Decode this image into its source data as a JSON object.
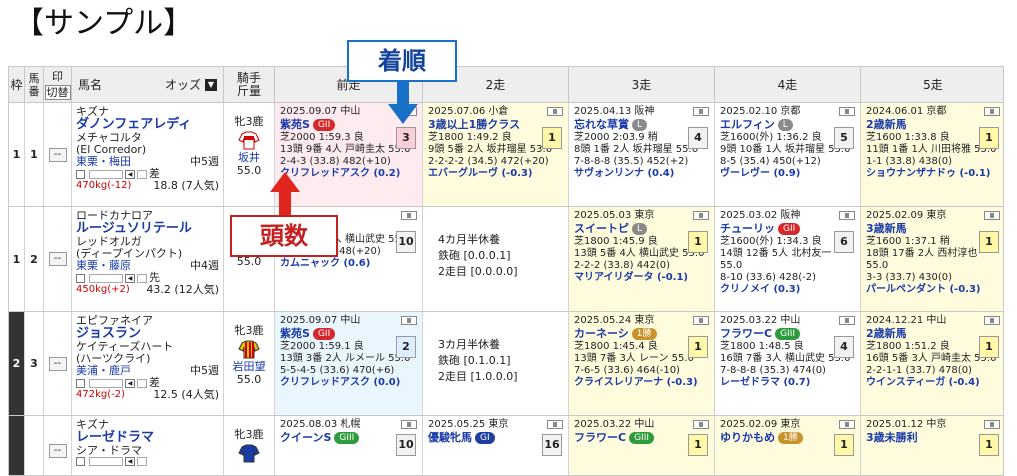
{
  "page_title": "【サンプル】",
  "callouts": {
    "finish": "着順",
    "heads": "頭数"
  },
  "header": {
    "waku": "枠",
    "umaban": "馬番",
    "mark": "印",
    "cut": "切替",
    "name": "馬名",
    "odds": "オッズ",
    "sort_icon": "sort-down-icon",
    "jockey": "騎手",
    "weight": "斤量",
    "races": [
      "前走",
      "2走",
      "3走",
      "4走",
      "5走"
    ]
  },
  "rows": [
    {
      "waku": "1",
      "uma": "1",
      "mark": "--",
      "sire": "キズナ",
      "name": "ダノンフェアレディ",
      "dam": "メチャコルタ",
      "dam_sire": "(El Corredor)",
      "trainer": "東栗・梅田",
      "rest": "中5週",
      "style": "差",
      "weight": "470kg(-12)",
      "odds": "18.8 (7人気)",
      "sex_age": "牝3鹿",
      "jockey": "坂井",
      "kinryo": "55.0",
      "races": [
        {
          "date": "2025.09.07 中山",
          "name": "紫苑S",
          "grade": "GII",
          "finish": "3",
          "info": "芝2000 1:59.3 良",
          "detail": "13頭 9番 4人 戸崎圭太 55.0",
          "pass": "2-4-3 (33.8) 482(+10)",
          "winner": "クリフレッドアスク (0.2)",
          "bg": "p",
          "fbox": "p"
        },
        {
          "date": "2025.07.06 小倉",
          "name": "3歳以上1勝クラス",
          "grade": "",
          "finish": "1",
          "info": "芝1800 1:49.2 良",
          "detail": "9頭 5番 2人 坂井瑠星 53.0",
          "pass": "2-2-2-2 (34.5) 472(+20)",
          "winner": "エバーグルーヴ (-0.3)",
          "bg": "y",
          "fbox": "y"
        },
        {
          "date": "2025.04.13 阪神",
          "name": "忘れな草賞",
          "grade": "L",
          "finish": "4",
          "info": "芝2000 2:03.9 稍",
          "detail": "8頭 1番 2人 坂井瑠星 55.0",
          "pass": "7-8-8-8 (35.5) 452(+2)",
          "winner": "サヴォンリンナ (0.4)",
          "bg": "",
          "fbox": "g"
        },
        {
          "date": "2025.02.10 京都",
          "name": "エルフィン",
          "grade": "L",
          "finish": "5",
          "info": "芝1600(外) 1:36.2 良",
          "detail": "9頭 10番 1人 坂井瑠星 55.0",
          "pass": "8-5 (35.4) 450(+12)",
          "winner": "ヴーレヴー (0.9)",
          "bg": "",
          "fbox": "g"
        },
        {
          "date": "2024.06.01 京都",
          "name": "2歳新馬",
          "grade": "",
          "finish": "1",
          "info": "芝1600 1:33.8 良",
          "detail": "11頭 1番 1人 川田将雅 55.0",
          "pass": "1-1 (33.8) 438(0)",
          "winner": "ショウナンザナドゥ (-0.1)",
          "bg": "y",
          "fbox": "y"
        }
      ]
    },
    {
      "waku": "1",
      "uma": "2",
      "mark": "--",
      "sire": "ロードカナロア",
      "name": "ルージュソリテール",
      "dam": "レッドオルガ",
      "dam_sire": "(ディープインパクト)",
      "trainer": "東栗・藤原",
      "rest": "中4週",
      "style": "先",
      "weight": "450kg(+2)",
      "odds": "43.2 (12人気)",
      "sex_age": "",
      "jockey": "北村友",
      "kinryo": "55.0",
      "races": [
        {
          "date": "神",
          "name": "",
          "grade": "",
          "finish": "10",
          "info": "4.1 良",
          "detail": "17頭 1番 4人 横山武史 55.0",
          "pass": "3-3 (35.3) 448(+20)",
          "winner": "カムニャック (0.6)",
          "bg": "",
          "fbox": "g"
        },
        {
          "rest": true,
          "text1": "4カ月半休養",
          "text2": "鉄砲 [0.0.0.1]",
          "text3": "2走目 [0.0.0.0]"
        },
        {
          "date": "2025.05.03 東京",
          "name": "スイートピ",
          "grade": "L",
          "finish": "1",
          "info": "芝1800 1:45.9 良",
          "detail": "13頭 5番 4人 横山武史 55.0",
          "pass": "2-2-2 (33.8) 442(0)",
          "winner": "マリアイリダータ (-0.1)",
          "bg": "y",
          "fbox": "y"
        },
        {
          "date": "2025.03.02 阪神",
          "name": "チューリッ",
          "grade": "GII",
          "finish": "6",
          "info": "芝1600(外) 1:34.3 良",
          "detail": "14頭 12番 5人 北村友一 55.0",
          "pass": "8-10 (33.6) 428(-2)",
          "winner": "クリノメイ (0.3)",
          "bg": "",
          "fbox": "g"
        },
        {
          "date": "2025.02.09 東京",
          "name": "3歳新馬",
          "grade": "",
          "finish": "1",
          "info": "芝1600 1:37.1 稍",
          "detail": "18頭 17番 2人 西村淳也 55.0",
          "pass": "3-3 (33.7) 430(0)",
          "winner": "パールペンダント (-0.3)",
          "bg": "y",
          "fbox": "y"
        }
      ]
    },
    {
      "waku": "2",
      "uma": "3",
      "mark": "--",
      "sire": "エピファネイア",
      "name": "ジョスラン",
      "dam": "ケイティーズハート",
      "dam_sire": "(ハーツクライ)",
      "trainer": "美浦・鹿戸",
      "rest": "中5週",
      "style": "差",
      "weight": "472kg(-2)",
      "odds": "12.5 (4人気)",
      "sex_age": "牝3鹿",
      "jockey": "岩田望",
      "kinryo": "55.0",
      "races": [
        {
          "date": "2025.09.07 中山",
          "name": "紫苑S",
          "grade": "GII",
          "finish": "2",
          "info": "芝2000 1:59.1 良",
          "detail": "13頭 3番 2人 ルメール 55.0",
          "pass": "5-5-4-5 (33.6) 470(+6)",
          "winner": "クリフレッドアスク (0.0)",
          "bg": "b",
          "fbox": "b"
        },
        {
          "rest": true,
          "text1": "3カ月半休養",
          "text2": "鉄砲 [0.1.0.1]",
          "text3": "2走目 [1.0.0.0]"
        },
        {
          "date": "2025.05.24 東京",
          "name": "カーネーシ",
          "grade": "1勝",
          "finish": "1",
          "info": "芝1800 1:45.4 良",
          "detail": "13頭 7番 3人 レーン 55.0",
          "pass": "7-6-5 (33.6) 464(-10)",
          "winner": "クライスレリアーナ (-0.3)",
          "bg": "y",
          "fbox": "y"
        },
        {
          "date": "2025.03.22 中山",
          "name": "フラワーC",
          "grade": "GIII",
          "finish": "4",
          "info": "芝1800 1:48.5 良",
          "detail": "16頭 7番 3人 横山武史 55.0",
          "pass": "7-8-8-8 (35.3) 474(0)",
          "winner": "レーゼドラマ (0.7)",
          "bg": "",
          "fbox": "g"
        },
        {
          "date": "2024.12.21 中山",
          "name": "2歳新馬",
          "grade": "",
          "finish": "1",
          "info": "芝1800 1:51.2 良",
          "detail": "16頭 5番 3人 戸崎圭太 55.0",
          "pass": "2-2-1-1 (33.7) 478(0)",
          "winner": "ウインスティーガ (-0.4)",
          "bg": "y",
          "fbox": "y"
        }
      ]
    },
    {
      "waku": "",
      "uma": "",
      "mark": "--",
      "sire": "キズナ",
      "name": "レーゼドラマ",
      "dam": "シア・ドラマ",
      "dam_sire": "",
      "trainer": "",
      "rest": "",
      "style": "",
      "weight": "",
      "odds": "",
      "sex_age": "牝3鹿",
      "jockey": "",
      "kinryo": "",
      "races": [
        {
          "date": "2025.08.03 札幌",
          "name": "クイーンS",
          "grade": "GIII",
          "finish": "10",
          "info": "",
          "detail": "",
          "pass": "",
          "winner": "",
          "bg": "",
          "fbox": "g"
        },
        {
          "date": "2025.05.25 東京",
          "name": "優駿牝馬",
          "grade": "GI",
          "finish": "16",
          "info": "",
          "detail": "",
          "pass": "",
          "winner": "",
          "bg": "",
          "fbox": "g"
        },
        {
          "date": "2025.03.22 中山",
          "name": "フラワーC",
          "grade": "GIII",
          "finish": "1",
          "info": "",
          "detail": "",
          "pass": "",
          "winner": "",
          "bg": "y",
          "fbox": "y"
        },
        {
          "date": "2025.02.09 東京",
          "name": "ゆりかもめ",
          "grade": "1勝",
          "finish": "1",
          "info": "",
          "detail": "",
          "pass": "",
          "winner": "",
          "bg": "y",
          "fbox": "y"
        },
        {
          "date": "2025.01.12 中京",
          "name": "3歳未勝利",
          "grade": "",
          "finish": "1",
          "info": "",
          "detail": "",
          "pass": "",
          "winner": "",
          "bg": "y",
          "fbox": "y"
        }
      ]
    }
  ]
}
